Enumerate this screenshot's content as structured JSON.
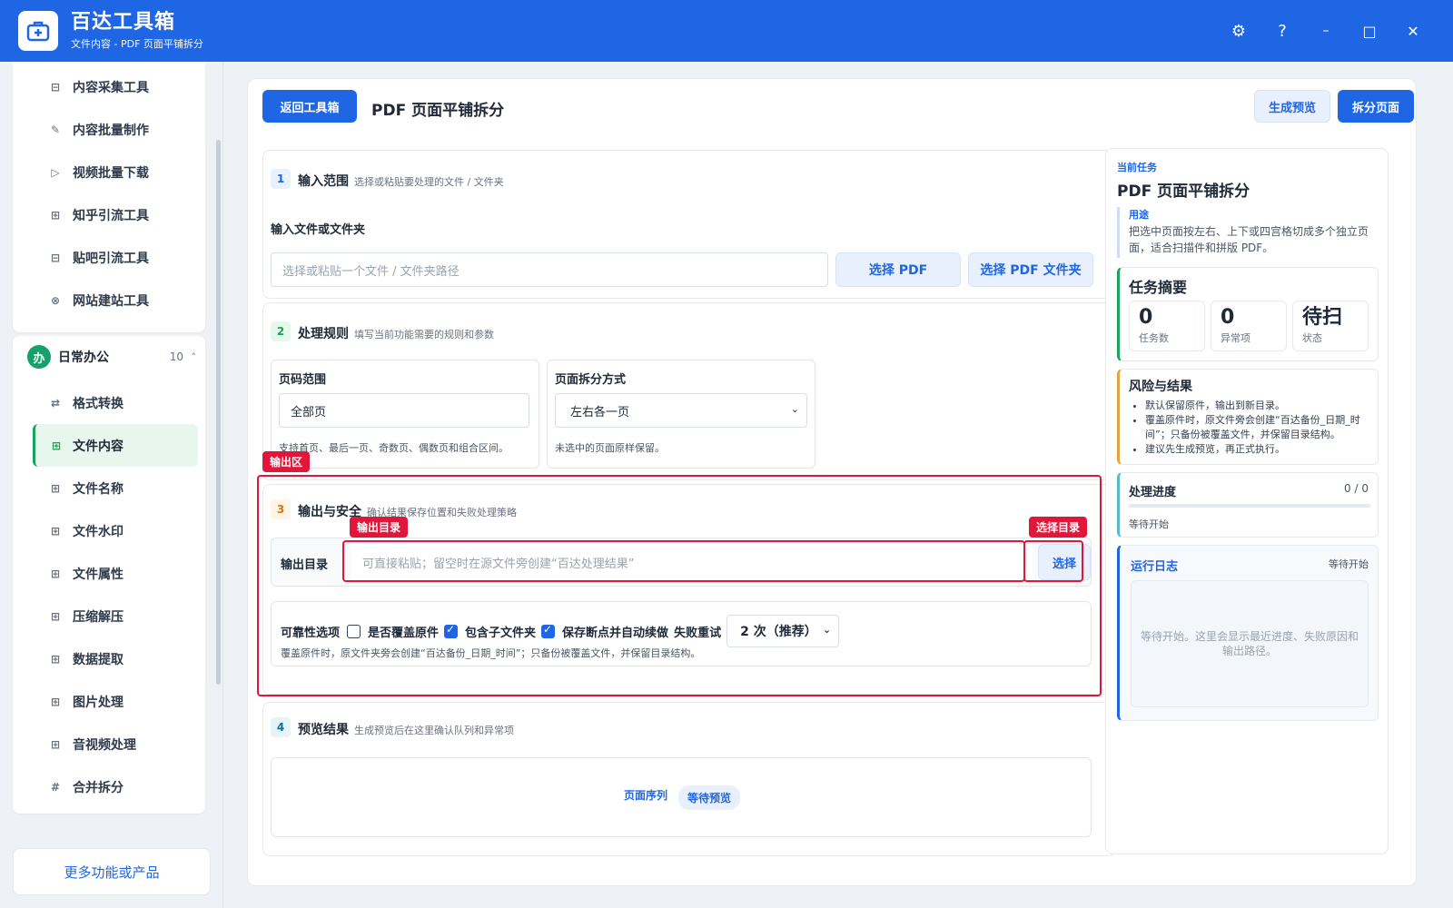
{
  "app": {
    "title": "百达工具箱",
    "subtitle": "文件内容 - PDF 页面平铺拆分"
  },
  "window_controls": {
    "settings": "⚙",
    "help": "?",
    "minimize": "–",
    "maximize": "□",
    "close": "✕"
  },
  "sidebar": {
    "top_items": [
      {
        "label": "内容采集工具",
        "icon": "⊟"
      },
      {
        "label": "内容批量制作",
        "icon": "✎"
      },
      {
        "label": "视频批量下载",
        "icon": "▷"
      },
      {
        "label": "知乎引流工具",
        "icon": "⊞"
      },
      {
        "label": "贴吧引流工具",
        "icon": "⊟"
      },
      {
        "label": "网站建站工具",
        "icon": "⊗"
      }
    ],
    "group": {
      "badge": "办",
      "title": "日常办公",
      "count": "10",
      "caret": "˄"
    },
    "group_items": [
      {
        "label": "格式转换",
        "icon": "⇄"
      },
      {
        "label": "文件内容",
        "icon": "⊞"
      },
      {
        "label": "文件名称",
        "icon": "⊞"
      },
      {
        "label": "文件水印",
        "icon": "⊞"
      },
      {
        "label": "文件属性",
        "icon": "⊞"
      },
      {
        "label": "压缩解压",
        "icon": "⊞"
      },
      {
        "label": "数据提取",
        "icon": "⊞"
      },
      {
        "label": "图片处理",
        "icon": "⊞"
      },
      {
        "label": "音视频处理",
        "icon": "⊞"
      },
      {
        "label": "合并拆分",
        "icon": "#"
      }
    ],
    "more_label": "更多功能或产品"
  },
  "header": {
    "back_label": "返回工具箱",
    "title": "PDF 页面平铺拆分",
    "preview_label": "生成预览",
    "run_label": "拆分页面"
  },
  "sections": {
    "input": {
      "num": "1",
      "title": "输入范围",
      "desc": "选择或粘贴要处理的文件 / 文件夹",
      "field_label": "输入文件或文件夹",
      "placeholder": "选择或粘贴一个文件 / 文件夹路径",
      "pick_pdf": "选择 PDF",
      "pick_folder": "选择 PDF 文件夹"
    },
    "rules": {
      "num": "2",
      "title": "处理规则",
      "desc": "填写当前功能需要的规则和参数",
      "page_range_label": "页码范围",
      "page_range_value": "全部页",
      "page_range_hint": "支持首页、最后一页、奇数页、偶数页和组合区间。",
      "split_mode_label": "页面拆分方式",
      "split_mode_value": "左右各一页",
      "split_mode_hint": "未选中的页面原样保留。"
    },
    "output": {
      "num": "3",
      "title": "输出与安全",
      "desc": "确认结果保存位置和失败处理策略",
      "dir_label": "输出目录",
      "dir_placeholder": "可直接粘贴；留空时在源文件旁创建“百达处理结果”",
      "choose_label": "选择",
      "reliability_label": "可靠性选项",
      "overwrite_label": "是否覆盖原件",
      "overwrite_checked": false,
      "subfolder_label": "包含子文件夹",
      "subfolder_checked": true,
      "resume_label": "保存断点并自动续做",
      "resume_checked": true,
      "retry_label": "失败重试",
      "retry_value": "2 次（推荐）",
      "note": "覆盖原件时，原文件夹旁会创建“百达备份_日期_时间”；只备份被覆盖文件，并保留目录结构。"
    },
    "preview": {
      "num": "4",
      "title": "预览结果",
      "desc": "生成预览后在这里确认队列和异常项",
      "seq_label": "页面序列",
      "status_badge": "等待预览"
    }
  },
  "annotations": {
    "output_area": "输出区",
    "output_dir": "输出目录",
    "choose_dir": "选择目录"
  },
  "right_panel": {
    "task_kicker": "当前任务",
    "task_title": "PDF 页面平铺拆分",
    "usage_label": "用途",
    "usage_text": "把选中页面按左右、上下或四宫格切成多个独立页面，适合扫描件和拼版 PDF。",
    "summary_title": "任务摘要",
    "stats": [
      {
        "value": "0",
        "label": "任务数"
      },
      {
        "value": "0",
        "label": "异常项"
      },
      {
        "value": "待扫",
        "label": "状态"
      }
    ],
    "risk_title": "风险与结果",
    "risks": [
      "默认保留原件，输出到新目录。",
      "覆盖原件时，原文件旁会创建“百达备份_日期_时间”；只备份被覆盖文件，并保留目录结构。",
      "建议先生成预览，再正式执行。"
    ],
    "progress_title": "处理进度",
    "progress_count": "0 / 0",
    "progress_fraction": 0,
    "progress_status": "等待开始",
    "log_title": "运行日志",
    "log_status": "等待开始",
    "log_placeholder": "等待开始。这里会显示最近进度、失败原因和输出路径。"
  },
  "colors": {
    "brand": "#1f66e5",
    "active_green": "#1aa35a",
    "annotation_red": "#e0173a"
  }
}
